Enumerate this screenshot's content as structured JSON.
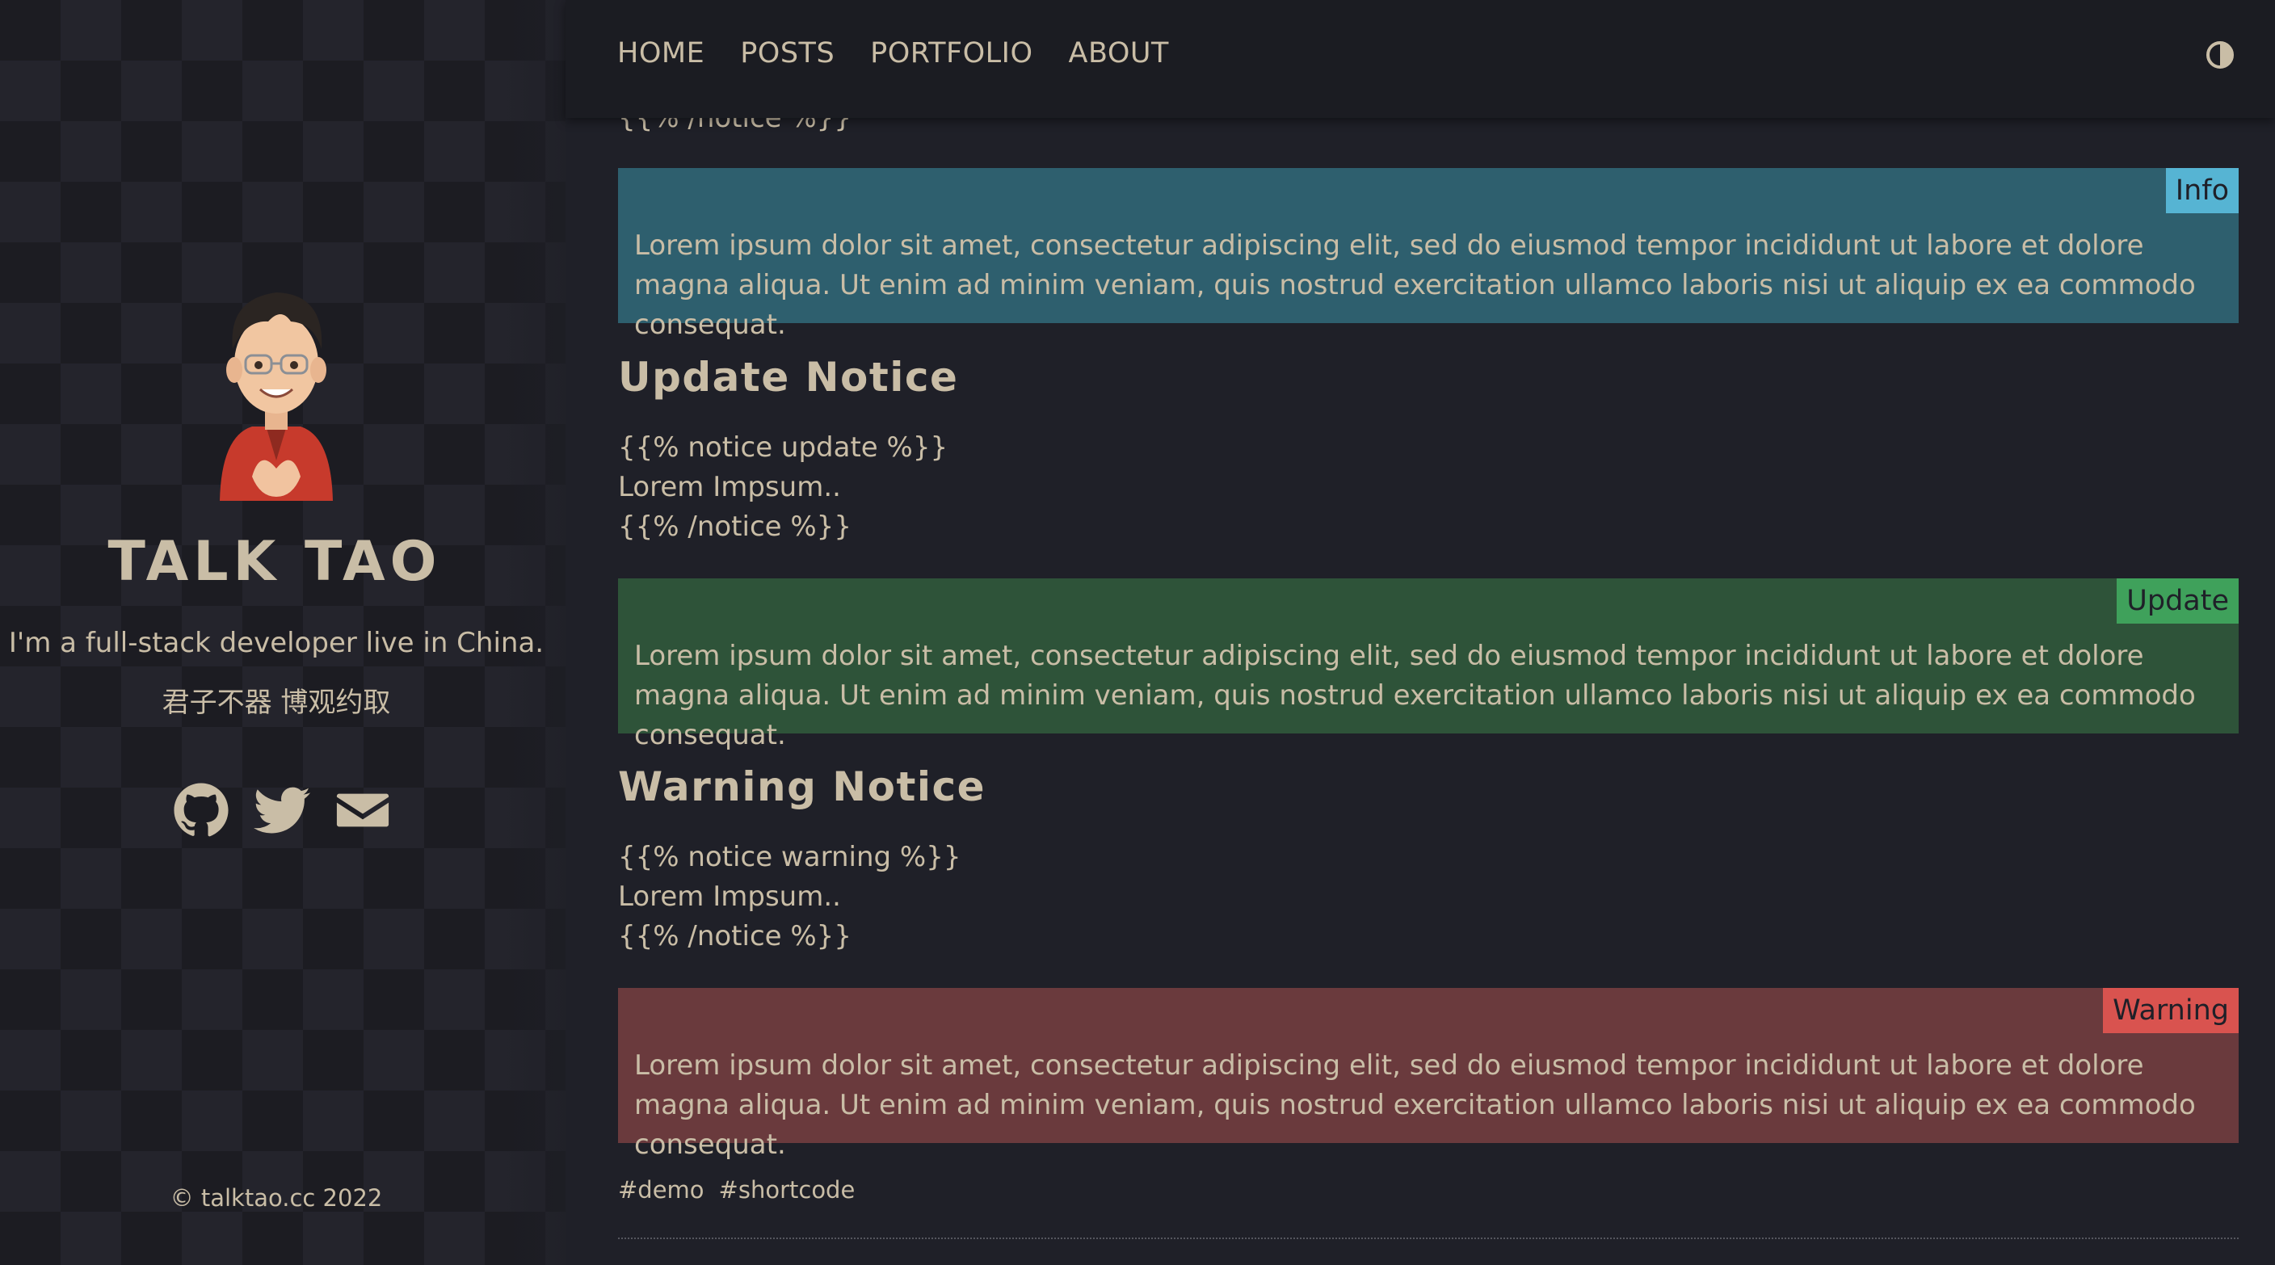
{
  "sidebar": {
    "title": "TALK TAO",
    "tagline": "I'm a full-stack developer live in China.",
    "motto": "君子不器 博观约取",
    "social": [
      "github-icon",
      "twitter-icon",
      "mail-icon"
    ],
    "copyright": "© talktao.cc 2022"
  },
  "nav": {
    "items": [
      "HOME",
      "POSTS",
      "PORTFOLIO",
      "ABOUT"
    ],
    "theme_icon": "contrast-icon"
  },
  "content": {
    "top_code_end": "{{% /notice %}}",
    "info": {
      "badge": "Info",
      "text": "Lorem ipsum dolor sit amet, consectetur adipiscing elit, sed do eiusmod tempor incididunt ut labore et dolore magna aliqua. Ut enim ad minim veniam, quis nostrud exercitation ullamco laboris nisi ut aliquip ex ea commodo consequat."
    },
    "update_heading": "Update Notice",
    "update_code": [
      "{{% notice update %}}",
      "Lorem Impsum..",
      "{{% /notice %}}"
    ],
    "update": {
      "badge": "Update",
      "text": "Lorem ipsum dolor sit amet, consectetur adipiscing elit, sed do eiusmod tempor incididunt ut labore et dolore magna aliqua. Ut enim ad minim veniam, quis nostrud exercitation ullamco laboris nisi ut aliquip ex ea commodo consequat."
    },
    "warning_heading": "Warning Notice",
    "warning_code": [
      "{{% notice warning %}}",
      "Lorem Impsum..",
      "{{% /notice %}}"
    ],
    "warning": {
      "badge": "Warning",
      "text": "Lorem ipsum dolor sit amet, consectetur adipiscing elit, sed do eiusmod tempor incididunt ut labore et dolore magna aliqua. Ut enim ad minim veniam, quis nostrud exercitation ullamco laboris nisi ut aliquip ex ea commodo consequat."
    },
    "tags": [
      "#demo",
      "#shortcode"
    ]
  },
  "colors": {
    "info_bg": "#2e5f6e",
    "info_badge": "#56b4d3",
    "update_bg": "#2e5339",
    "update_badge": "#3fa15b",
    "warning_bg": "#6a3a3d",
    "warning_badge": "#d9534f"
  }
}
